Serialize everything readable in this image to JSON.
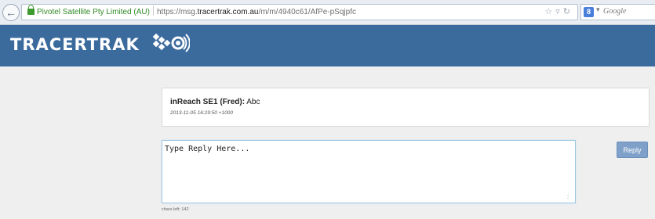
{
  "browser": {
    "site_name": "Pivotel Satellite Pty Limited (AU)",
    "url_prefix": "https://msg.",
    "url_domain": "tracertrak.com.au",
    "url_path": "/m/m/4940c61/AfPe-pSqjpfc",
    "search_engine": "Google",
    "icons": [
      "back-arrow-icon",
      "lock-icon",
      "star-icon",
      "dropdown-arrow-icon",
      "reload-icon",
      "google-icon"
    ]
  },
  "header": {
    "logo_text": "TRACERTRAK",
    "background_color": "#3b6a9d"
  },
  "message": {
    "sender": "inReach SE1 (Fred):",
    "body": "Abc",
    "timestamp": "2013-11-05 16:29:50 +1000"
  },
  "reply": {
    "placeholder": "Type Reply Here...",
    "button_label": "Reply",
    "chars_left": "chars left: 142"
  }
}
